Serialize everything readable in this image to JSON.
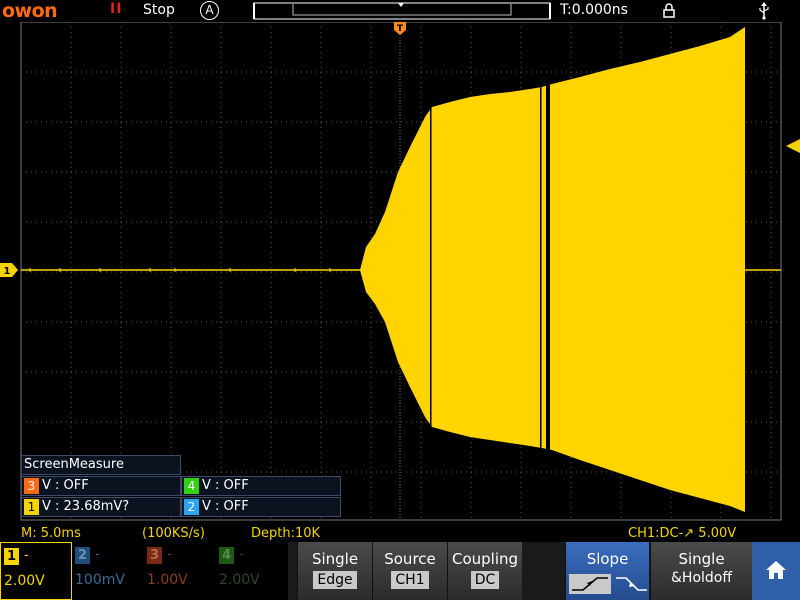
{
  "topbar": {
    "logo": "owon",
    "run_icon": "II",
    "run_status": "Stop",
    "acq_icon": "A",
    "trigger_time": "T:0.000ns"
  },
  "markers": {
    "trigger_marker": "T",
    "ch1_marker": "1"
  },
  "measure": {
    "title": "ScreenMeasure",
    "cells": [
      {
        "channel": "3",
        "text": "V : OFF",
        "color": "#ff6a13"
      },
      {
        "channel": "4",
        "text": "V : OFF",
        "color": "#31d212"
      },
      {
        "channel": "1",
        "text": "V : 23.68mV?",
        "color": "#f5d400"
      },
      {
        "channel": "2",
        "text": "V : OFF",
        "color": "#2ea3f2"
      }
    ]
  },
  "infoline": {
    "timebase": "M: 5.0ms",
    "sample_rate": "(100KS/s)",
    "depth": "Depth:10K",
    "trigger_info": "CH1:DC-↗ 5.00V"
  },
  "channels": [
    {
      "num": "1",
      "dash": "-",
      "scale": "2.00V",
      "color": "#f5d400",
      "text_color": "#f5d400",
      "active": true
    },
    {
      "num": "2",
      "dash": "-",
      "scale": "100mV",
      "color": "#1d4f7a",
      "text_color": "#3a6a94",
      "active": false
    },
    {
      "num": "3",
      "dash": "-",
      "scale": "1.00V",
      "color": "#7a2a12",
      "text_color": "#8a3a20",
      "active": false
    },
    {
      "num": "4",
      "dash": "-",
      "scale": "2.00V",
      "color": "#1f5a14",
      "text_color": "#2a4a22",
      "active": false
    }
  ],
  "softkeys": [
    {
      "label": "Single",
      "value": "Edge"
    },
    {
      "label": "Source",
      "value": "CH1"
    },
    {
      "label": "Coupling",
      "value": "DC"
    },
    {
      "label": "Slope",
      "value": ""
    },
    {
      "label": "Single",
      "value": "&Holdoff"
    }
  ],
  "colors": {
    "trace": "#ffd400",
    "grid": "#5a5a5a",
    "accent": "#ff6a13",
    "menu_selected": "#2f5fa8"
  },
  "icons": {
    "home": "home-icon",
    "lock": "lock-icon",
    "usb": "usb-icon",
    "acquire": "acquire-mode-icon"
  }
}
